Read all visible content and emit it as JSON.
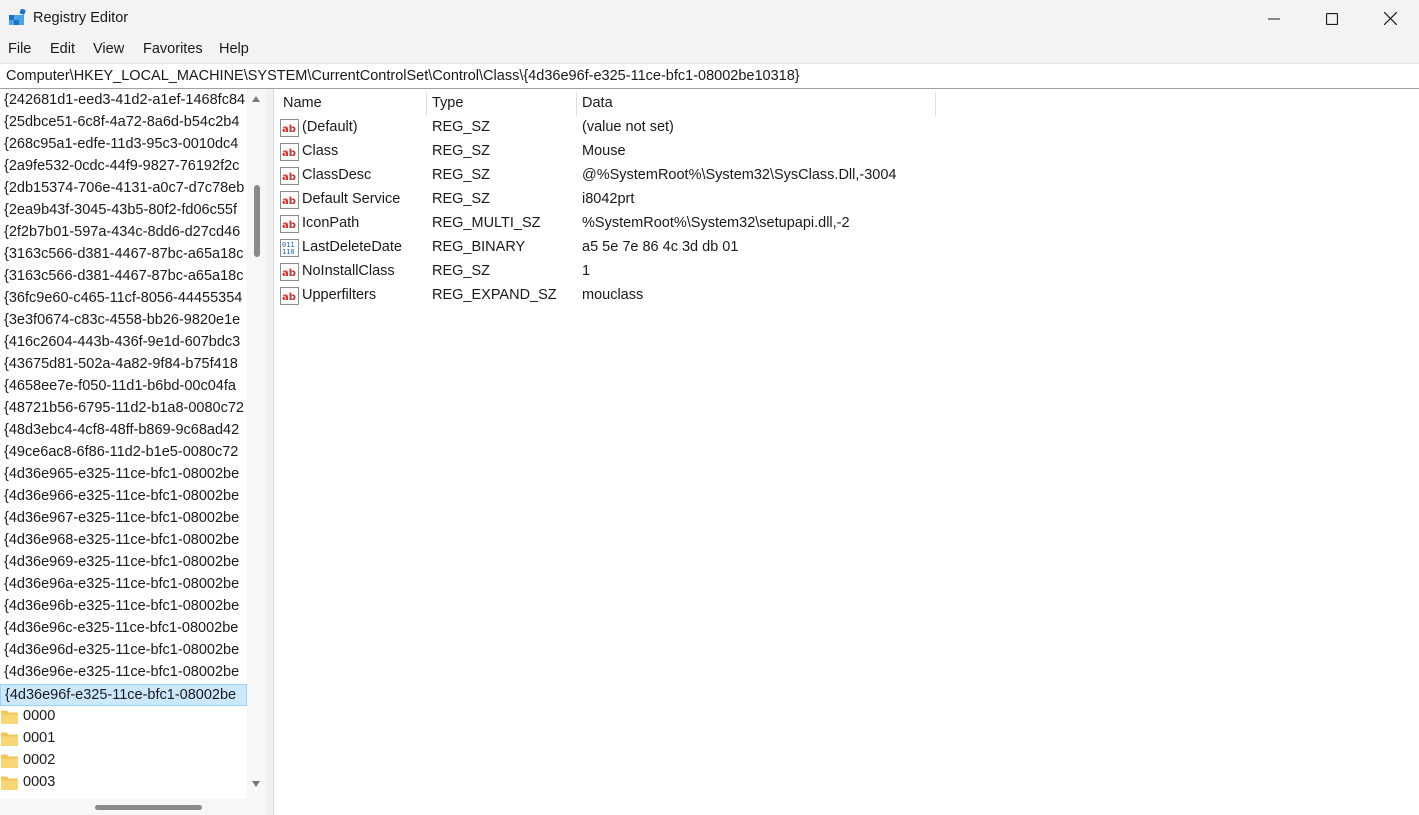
{
  "window": {
    "title": "Registry Editor",
    "accent": "#0078d4"
  },
  "menu": [
    "File",
    "Edit",
    "View",
    "Favorites",
    "Help"
  ],
  "address": "Computer\\HKEY_LOCAL_MACHINE\\SYSTEM\\CurrentControlSet\\Control\\Class\\{4d36e96f-e325-11ce-bfc1-08002be10318}",
  "tree": {
    "keys": [
      "{242681d1-eed3-41d2-a1ef-1468fc84",
      "{25dbce51-6c8f-4a72-8a6d-b54c2b4",
      "{268c95a1-edfe-11d3-95c3-0010dc4",
      "{2a9fe532-0cdc-44f9-9827-76192f2c",
      "{2db15374-706e-4131-a0c7-d7c78eb",
      "{2ea9b43f-3045-43b5-80f2-fd06c55f",
      "{2f2b7b01-597a-434c-8dd6-d27cd46",
      "{3163c566-d381-4467-87bc-a65a18c",
      "{3163c566-d381-4467-87bc-a65a18c",
      "{36fc9e60-c465-11cf-8056-44455354",
      "{3e3f0674-c83c-4558-bb26-9820e1e",
      "{416c2604-443b-436f-9e1d-607bdc3",
      "{43675d81-502a-4a82-9f84-b75f418",
      "{4658ee7e-f050-11d1-b6bd-00c04fa",
      "{48721b56-6795-11d2-b1a8-0080c72",
      "{48d3ebc4-4cf8-48ff-b869-9c68ad42",
      "{49ce6ac8-6f86-11d2-b1e5-0080c72",
      "{4d36e965-e325-11ce-bfc1-08002be",
      "{4d36e966-e325-11ce-bfc1-08002be",
      "{4d36e967-e325-11ce-bfc1-08002be",
      "{4d36e968-e325-11ce-bfc1-08002be",
      "{4d36e969-e325-11ce-bfc1-08002be",
      "{4d36e96a-e325-11ce-bfc1-08002be",
      "{4d36e96b-e325-11ce-bfc1-08002be",
      "{4d36e96c-e325-11ce-bfc1-08002be",
      "{4d36e96d-e325-11ce-bfc1-08002be",
      "{4d36e96e-e325-11ce-bfc1-08002be",
      "{4d36e96f-e325-11ce-bfc1-08002be"
    ],
    "selected_index": 27,
    "subkeys": [
      "0000",
      "0001",
      "0002",
      "0003"
    ],
    "folder_color": "#f2c55c",
    "selected_bg": "#cce8ff"
  },
  "columns": [
    "Name",
    "Type",
    "Data"
  ],
  "values": [
    {
      "icon": "string-value-icon",
      "name": "(Default)",
      "type": "REG_SZ",
      "data": "(value not set)"
    },
    {
      "icon": "string-value-icon",
      "name": "Class",
      "type": "REG_SZ",
      "data": "Mouse"
    },
    {
      "icon": "string-value-icon",
      "name": "ClassDesc",
      "type": "REG_SZ",
      "data": "@%SystemRoot%\\System32\\SysClass.Dll,-3004"
    },
    {
      "icon": "string-value-icon",
      "name": "Default Service",
      "type": "REG_SZ",
      "data": "i8042prt"
    },
    {
      "icon": "string-value-icon",
      "name": "IconPath",
      "type": "REG_MULTI_SZ",
      "data": "%SystemRoot%\\System32\\setupapi.dll,-2"
    },
    {
      "icon": "binary-value-icon",
      "name": "LastDeleteDate",
      "type": "REG_BINARY",
      "data": "a5 5e 7e 86 4c 3d db 01"
    },
    {
      "icon": "string-value-icon",
      "name": "NoInstallClass",
      "type": "REG_SZ",
      "data": "1"
    },
    {
      "icon": "string-value-icon",
      "name": "Upperfilters",
      "type": "REG_EXPAND_SZ",
      "data": "mouclass"
    }
  ]
}
